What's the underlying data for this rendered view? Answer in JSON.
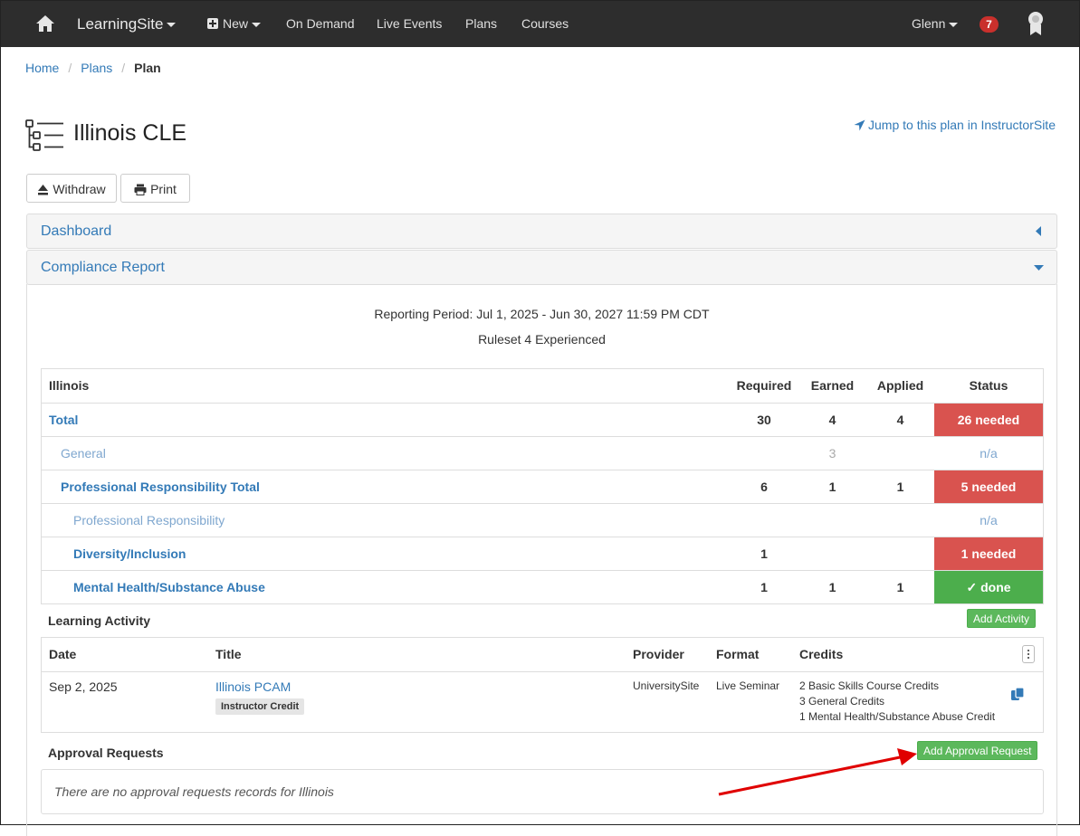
{
  "nav": {
    "brand": "LearningSite",
    "new_label": "New",
    "items": [
      "On Demand",
      "Live Events",
      "Plans",
      "Courses"
    ],
    "user": "Glenn",
    "notification_count": "7"
  },
  "breadcrumb": {
    "home": "Home",
    "plans": "Plans",
    "current": "Plan"
  },
  "page": {
    "title": "Illinois CLE",
    "jump_link": "Jump to this plan in InstructorSite",
    "withdraw_label": "Withdraw",
    "print_label": "Print"
  },
  "panels": {
    "dashboard": "Dashboard",
    "compliance": "Compliance Report"
  },
  "report": {
    "period": "Reporting Period: Jul 1, 2025 - Jun 30, 2027 11:59 PM CDT",
    "ruleset": "Ruleset 4 Experienced"
  },
  "compliance_table": {
    "headers": {
      "name": "Illinois",
      "required": "Required",
      "earned": "Earned",
      "applied": "Applied",
      "status": "Status"
    },
    "rows": [
      {
        "name": "Total",
        "required": "30",
        "earned": "4",
        "applied": "4",
        "status": "26 needed"
      },
      {
        "name": "General",
        "required": "",
        "earned": "3",
        "applied": "",
        "status": "n/a"
      },
      {
        "name": "Professional Responsibility Total",
        "required": "6",
        "earned": "1",
        "applied": "1",
        "status": "5 needed"
      },
      {
        "name": "Professional Responsibility",
        "required": "",
        "earned": "",
        "applied": "",
        "status": "n/a"
      },
      {
        "name": "Diversity/Inclusion",
        "required": "1",
        "earned": "",
        "applied": "",
        "status": "1 needed"
      },
      {
        "name": "Mental Health/Substance Abuse",
        "required": "1",
        "earned": "1",
        "applied": "1",
        "status": "✓ done"
      }
    ]
  },
  "learning_activity": {
    "label": "Learning Activity",
    "add_button": "Add Activity",
    "headers": {
      "date": "Date",
      "title": "Title",
      "provider": "Provider",
      "format": "Format",
      "credits": "Credits"
    },
    "rows": [
      {
        "date": "Sep 2, 2025",
        "title": "Illinois PCAM",
        "tag": "Instructor Credit",
        "provider": "UniversitySite",
        "format": "Live Seminar",
        "credits": [
          "2 Basic Skills Course Credits",
          "3 General Credits",
          "1 Mental Health/Substance Abuse Credit"
        ]
      }
    ]
  },
  "approval_requests": {
    "label": "Approval Requests",
    "add_button": "Add Approval Request",
    "empty_text": "There are no approval requests records for Illinois"
  },
  "colors": {
    "navbar": "#2d2d2d",
    "link": "#337ab7",
    "danger": "#d9534f",
    "success": "#4cae4c",
    "annotation_arrow": "#e00000"
  }
}
